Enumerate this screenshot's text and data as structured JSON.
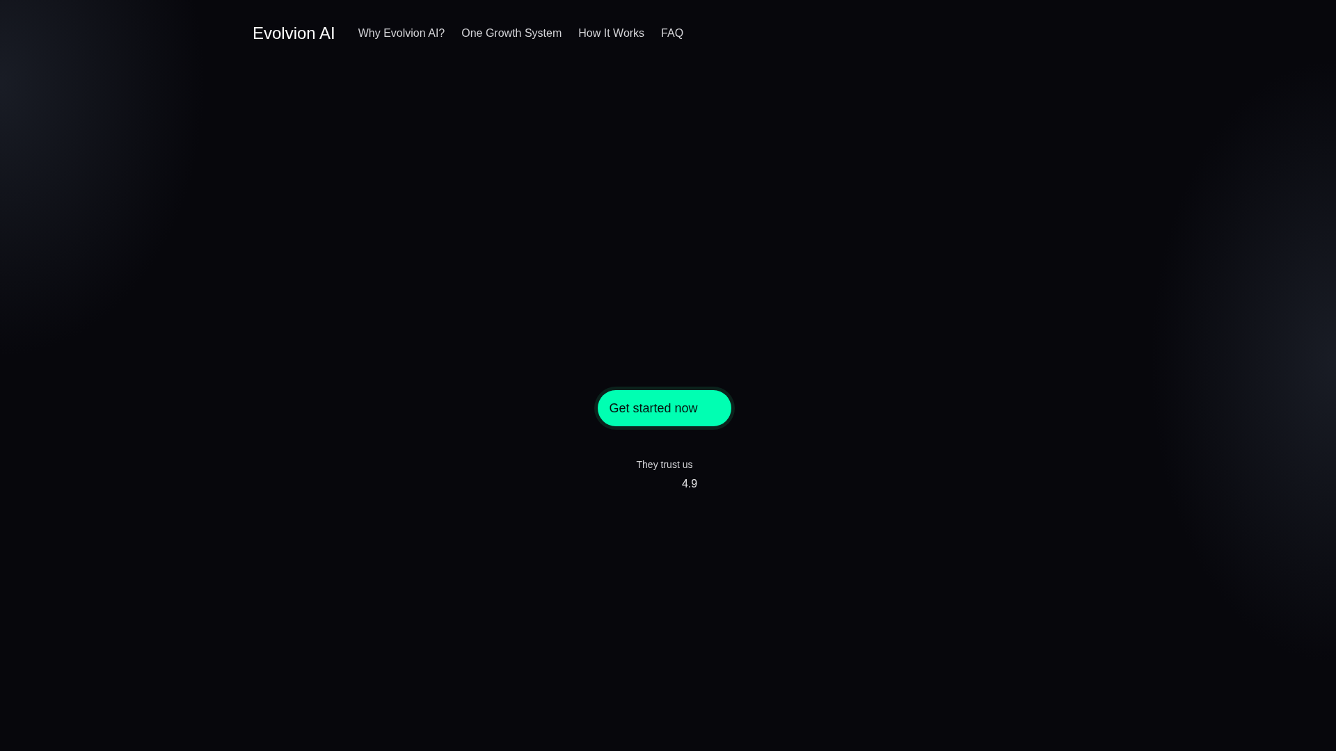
{
  "header": {
    "logo": "Evolvion AI",
    "nav": [
      "Why Evolvion AI?",
      "One Growth System",
      "How It Works",
      "FAQ"
    ]
  },
  "hero": {
    "cta": "Get started now",
    "trust_label": "They trust us",
    "rating": "4.9"
  }
}
